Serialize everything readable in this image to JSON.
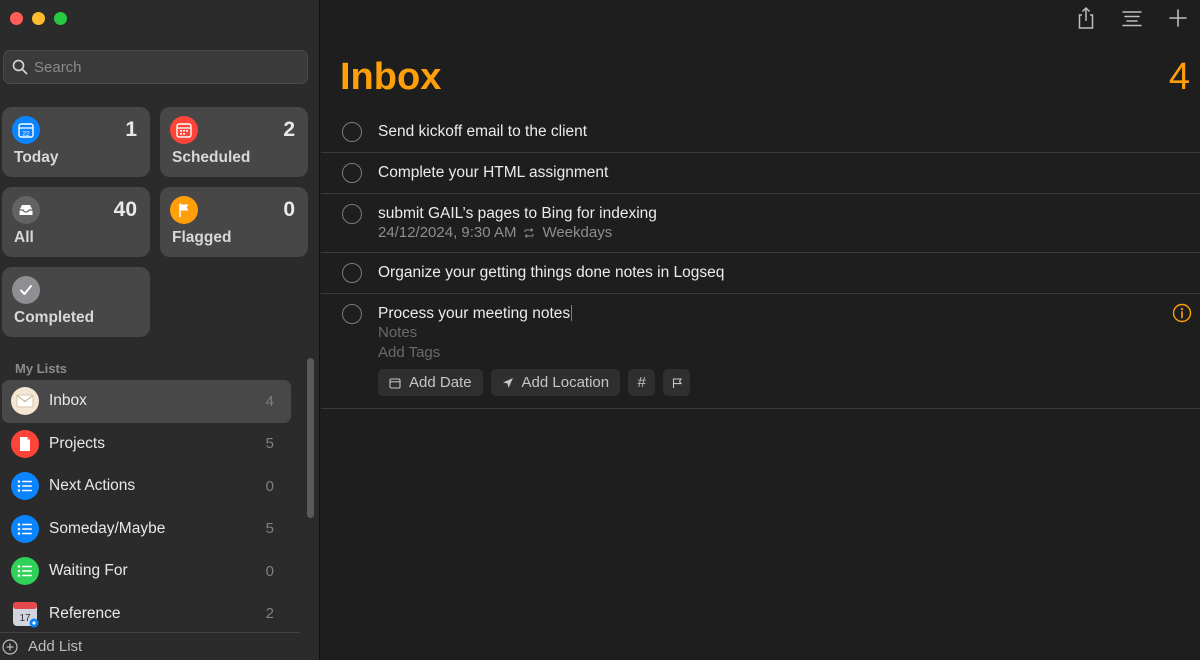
{
  "sidebar": {
    "search_placeholder": "Search",
    "smart_lists": [
      {
        "name": "Today",
        "count": "1",
        "color": "#0a84ff",
        "icon": "calendar-today-icon",
        "icon_text": "22"
      },
      {
        "name": "Scheduled",
        "count": "2",
        "color": "#ff453a",
        "icon": "calendar-scheduled-icon"
      },
      {
        "name": "All",
        "count": "40",
        "color": "#636366",
        "icon": "tray-icon"
      },
      {
        "name": "Flagged",
        "count": "0",
        "color": "#ff9f0a",
        "icon": "flag-icon"
      },
      {
        "name": "Completed",
        "count": "",
        "color": "#8e8e93",
        "icon": "checkmark-icon"
      }
    ],
    "my_lists_header": "My Lists",
    "lists": [
      {
        "name": "Inbox",
        "count": "4",
        "color": "#f5e6d3",
        "icon": "envelope-icon",
        "selected": true
      },
      {
        "name": "Projects",
        "count": "5",
        "color": "#ff453a",
        "icon": "document-icon"
      },
      {
        "name": "Next Actions",
        "count": "0",
        "color": "#0a84ff",
        "icon": "list-bullet-icon"
      },
      {
        "name": "Someday/Maybe",
        "count": "5",
        "color": "#0a84ff",
        "icon": "list-bullet-icon"
      },
      {
        "name": "Waiting For",
        "count": "0",
        "color": "#30d158",
        "icon": "list-bullet-icon"
      },
      {
        "name": "Reference",
        "count": "2",
        "color": "#d0d4dc",
        "icon": "calendar-file-icon",
        "icon_text": "17"
      }
    ],
    "add_list_label": "Add List"
  },
  "main": {
    "title": "Inbox",
    "count": "4",
    "accent": "#ff9f0a",
    "toolbar": [
      "share-icon",
      "view-options-icon",
      "add-icon"
    ],
    "tasks": [
      {
        "title": "Send kickoff email to the client"
      },
      {
        "title": "Complete your HTML assignment"
      },
      {
        "title": "submit GAIL’s pages to Bing for indexing",
        "date": "24/12/2024, 9:30 AM",
        "repeat": "Weekdays"
      },
      {
        "title": "Organize your getting things done notes in Logseq"
      },
      {
        "title": "Process your meeting notes",
        "notes_placeholder": "Notes",
        "tags_placeholder": "Add Tags",
        "add_date": "Add Date",
        "add_location": "Add Location",
        "tag_symbol": "#"
      }
    ]
  }
}
